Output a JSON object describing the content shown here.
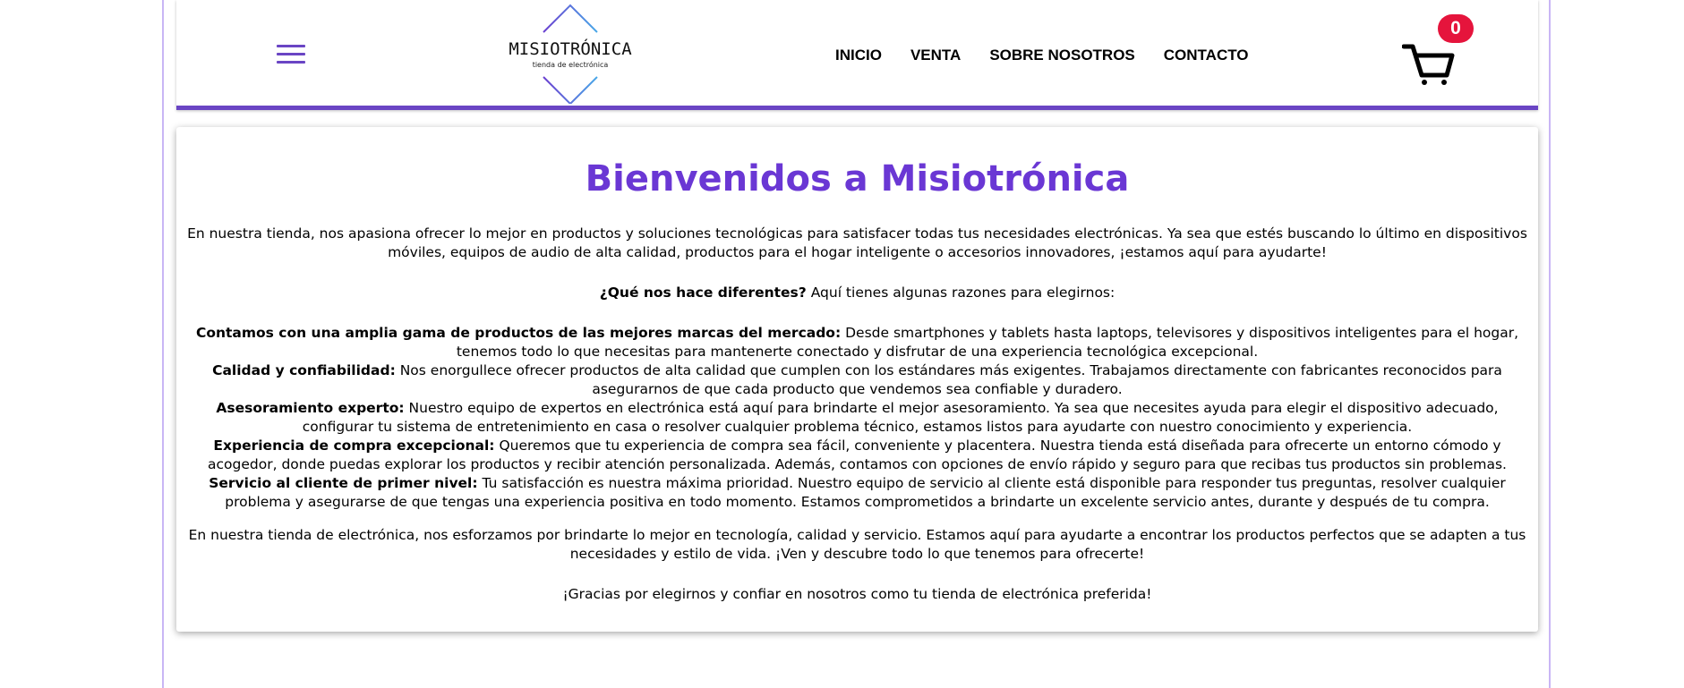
{
  "header": {
    "logo": {
      "title": "MISIOTRÓNICA",
      "subtitle": "tienda de electrónica"
    },
    "nav": [
      "INICIO",
      "VENTA",
      "SOBRE NOSOTROS",
      "CONTACTO"
    ],
    "cart_count": "0",
    "accent_color": "#6a45c4",
    "badge_color": "#e5143c"
  },
  "main": {
    "title": "Bienvenidos a Misiotrónica",
    "intro": "En nuestra tienda, nos apasiona ofrecer lo mejor en productos y soluciones tecnológicas para satisfacer todas tus necesidades electrónicas. Ya sea que estés buscando lo último en dispositivos móviles, equipos de audio de alta calidad, productos para el hogar inteligente o accesorios innovadores, ¡estamos aquí para ayudarte!",
    "why_bold": "¿Qué nos hace diferentes?",
    "why_text": " Aquí tienes algunas razones para elegirnos:",
    "reasons": [
      {
        "bold": "Contamos con una amplia gama de productos de las mejores marcas del mercado:",
        "text": " Desde smartphones y tablets hasta laptops, televisores y dispositivos inteligentes para el hogar, tenemos todo lo que necesitas para mantenerte conectado y disfrutar de una experiencia tecnológica excepcional."
      },
      {
        "bold": "Calidad y confiabilidad:",
        "text": " Nos enorgullece ofrecer productos de alta calidad que cumplen con los estándares más exigentes. Trabajamos directamente con fabricantes reconocidos para asegurarnos de que cada producto que vendemos sea confiable y duradero."
      },
      {
        "bold": "Asesoramiento experto:",
        "text": " Nuestro equipo de expertos en electrónica está aquí para brindarte el mejor asesoramiento. Ya sea que necesites ayuda para elegir el dispositivo adecuado, configurar tu sistema de entretenimiento en casa o resolver cualquier problema técnico, estamos listos para ayudarte con nuestro conocimiento y experiencia."
      },
      {
        "bold": "Experiencia de compra excepcional:",
        "text": " Queremos que tu experiencia de compra sea fácil, conveniente y placentera. Nuestra tienda está diseñada para ofrecerte un entorno cómodo y acogedor, donde puedas explorar los productos y recibir atención personalizada. Además, contamos con opciones de envío rápido y seguro para que recibas tus productos sin problemas."
      },
      {
        "bold": "Servicio al cliente de primer nivel:",
        "text": " Tu satisfacción es nuestra máxima prioridad. Nuestro equipo de servicio al cliente está disponible para responder tus preguntas, resolver cualquier problema y asegurarse de que tengas una experiencia positiva en todo momento. Estamos comprometidos a brindarte un excelente servicio antes, durante y después de tu compra."
      }
    ],
    "outro": "En nuestra tienda de electrónica, nos esforzamos por brindarte lo mejor en tecnología, calidad y servicio. Estamos aquí para ayudarte a encontrar los productos perfectos que se adapten a tus necesidades y estilo de vida. ¡Ven y descubre todo lo que tenemos para ofrecerte!",
    "thanks": "¡Gracias por elegirnos y confiar en nosotros como tu tienda de electrónica preferida!",
    "title_color": "#6a37d4"
  }
}
